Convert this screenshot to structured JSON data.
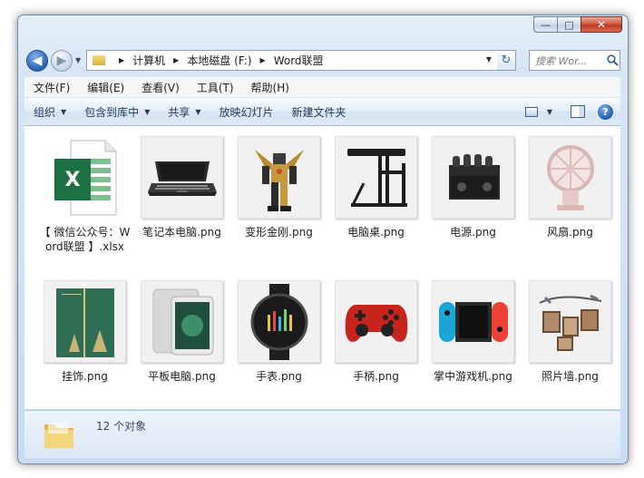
{
  "window": {
    "caption_buttons": {
      "minimize": "—",
      "maximize": "□",
      "close": "✕"
    }
  },
  "nav": {
    "back_glyph": "◀",
    "forward_glyph": "▶",
    "breadcrumbs": [
      "计算机",
      "本地磁盘 (F:)",
      "Word联盟"
    ],
    "refresh_glyph": "↻",
    "search_placeholder": "搜索 Wor...",
    "search_icon": "search-icon"
  },
  "menubar": {
    "items": [
      "文件(F)",
      "编辑(E)",
      "查看(V)",
      "工具(T)",
      "帮助(H)"
    ]
  },
  "commandbar": {
    "organize": "组织",
    "include_library": "包含到库中",
    "share": "共享",
    "slideshow": "放映幻灯片",
    "new_folder": "新建文件夹",
    "help_glyph": "?"
  },
  "files": [
    {
      "name": "【 微信公众号：Word联盟 】.xlsx",
      "icon": "excel-icon"
    },
    {
      "name": "笔记本电脑.png",
      "icon": "laptop-icon"
    },
    {
      "name": "变形金刚.png",
      "icon": "robot-icon"
    },
    {
      "name": "电脑桌.png",
      "icon": "desk-icon"
    },
    {
      "name": "电源.png",
      "icon": "amplifier-icon"
    },
    {
      "name": "风扇.png",
      "icon": "fan-icon"
    },
    {
      "name": "挂饰.png",
      "icon": "card-icon"
    },
    {
      "name": "平板电脑.png",
      "icon": "tablet-icon"
    },
    {
      "name": "手表.png",
      "icon": "watch-icon"
    },
    {
      "name": "手柄.png",
      "icon": "gamepad-icon"
    },
    {
      "name": "掌中游戏机.png",
      "icon": "switch-icon"
    },
    {
      "name": "照片墙.png",
      "icon": "photo-wall-icon"
    }
  ],
  "details": {
    "status": "12 个对象"
  }
}
